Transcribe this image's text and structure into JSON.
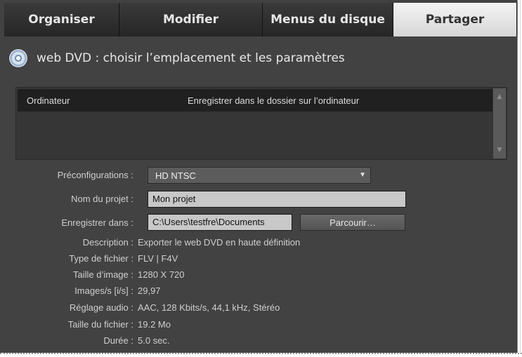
{
  "tabs": [
    {
      "label": "Organiser",
      "active": false
    },
    {
      "label": "Modifier",
      "active": false
    },
    {
      "label": "Menus du disque",
      "active": false
    },
    {
      "label": "Partager",
      "active": true
    }
  ],
  "header": {
    "icon": "disc-icon",
    "title": "web DVD : choisir l’emplacement et les paramètres"
  },
  "destination_list": {
    "rows": [
      {
        "name": "Ordinateur",
        "description": "Enregistrer dans le dossier sur l’ordinateur"
      }
    ]
  },
  "form": {
    "presets_label": "Préconfigurations :",
    "presets_value": "HD NTSC",
    "project_name_label": "Nom du projet :",
    "project_name_value": "Mon projet",
    "save_in_label": "Enregistrer dans :",
    "save_in_value": "C:\\Users\\testfre\\Documents",
    "browse_label": "Parcourir…"
  },
  "info": [
    {
      "label": "Description :",
      "value": "Exporter le web DVD en haute définition"
    },
    {
      "label": "Type de fichier :",
      "value": "FLV | F4V"
    },
    {
      "label": "Taille d’image :",
      "value": "1280 X 720"
    },
    {
      "label": "Images/s [i/s] :",
      "value": "29,97"
    },
    {
      "label": "Réglage audio :",
      "value": "AAC, 128 Kbits/s, 44,1 kHz, Stéréo"
    },
    {
      "label": "Taille du fichier :",
      "value": "19.2 Mo"
    },
    {
      "label": "Durée :",
      "value": "5.0 sec."
    }
  ],
  "colors": {
    "panel_bg": "#424242",
    "active_tab_bg": "#e6e6e6",
    "list_header_bg": "#202020"
  }
}
